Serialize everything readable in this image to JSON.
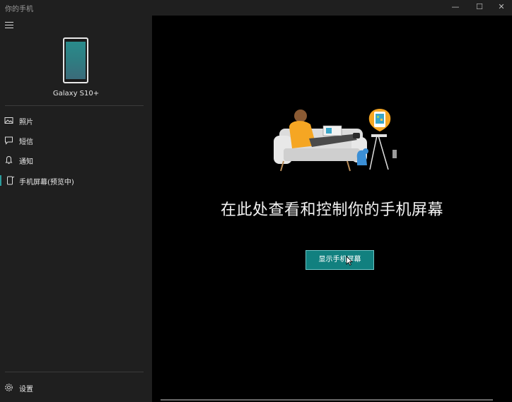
{
  "window": {
    "title": "你的手机",
    "minimize_glyph": "—",
    "maximize_glyph": "☐",
    "close_glyph": "✕"
  },
  "sidebar": {
    "device_name": "Galaxy S10+",
    "items": [
      {
        "label": "照片",
        "icon": "photo-icon"
      },
      {
        "label": "短信",
        "icon": "message-icon"
      },
      {
        "label": "通知",
        "icon": "bell-icon"
      },
      {
        "label": "手机屏幕(预览中)",
        "icon": "phone-screen-icon",
        "active": true
      }
    ],
    "settings_label": "设置"
  },
  "main": {
    "headline": "在此处查看和控制你的手机屏幕",
    "button_label": "显示手机屏幕"
  },
  "colors": {
    "accent": "#11807f",
    "sidebar_bg": "#1f1f1f",
    "main_bg": "#000000"
  }
}
